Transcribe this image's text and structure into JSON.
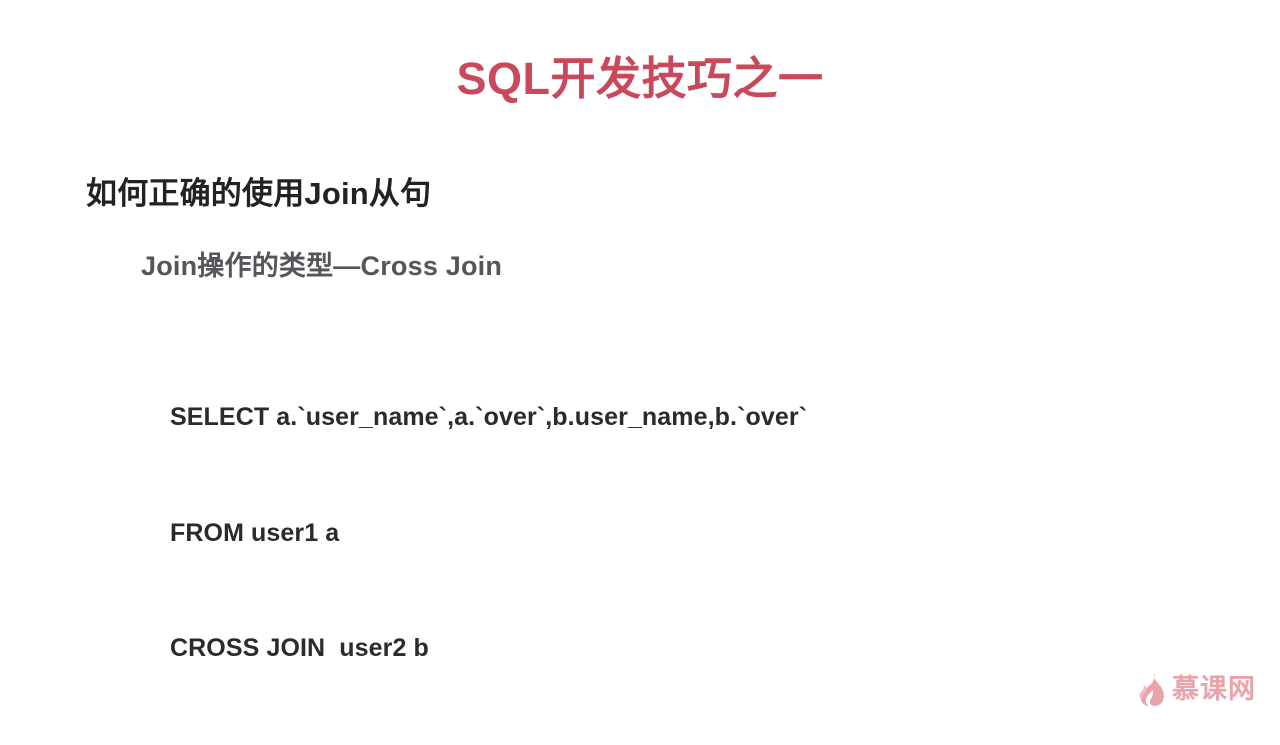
{
  "slide": {
    "background_color": "#ffffff",
    "title": "SQL开发技巧之一",
    "title_color": "#c9495a",
    "heading_l1": "如何正确的使用Join从句",
    "heading_l1_color": "#222222",
    "heading_l2": "Join操作的类型—Cross Join",
    "heading_l2_color": "#54565a",
    "code": {
      "language": "sql",
      "color": "#2b2b2b",
      "lines": [
        "SELECT a.`user_name`,a.`over`,b.user_name,b.`over`",
        "FROM user1 a",
        "CROSS JOIN  user2 b"
      ]
    }
  },
  "watermark": {
    "icon": "flame-icon",
    "text": "慕课网",
    "color": "#e9a3ab"
  }
}
